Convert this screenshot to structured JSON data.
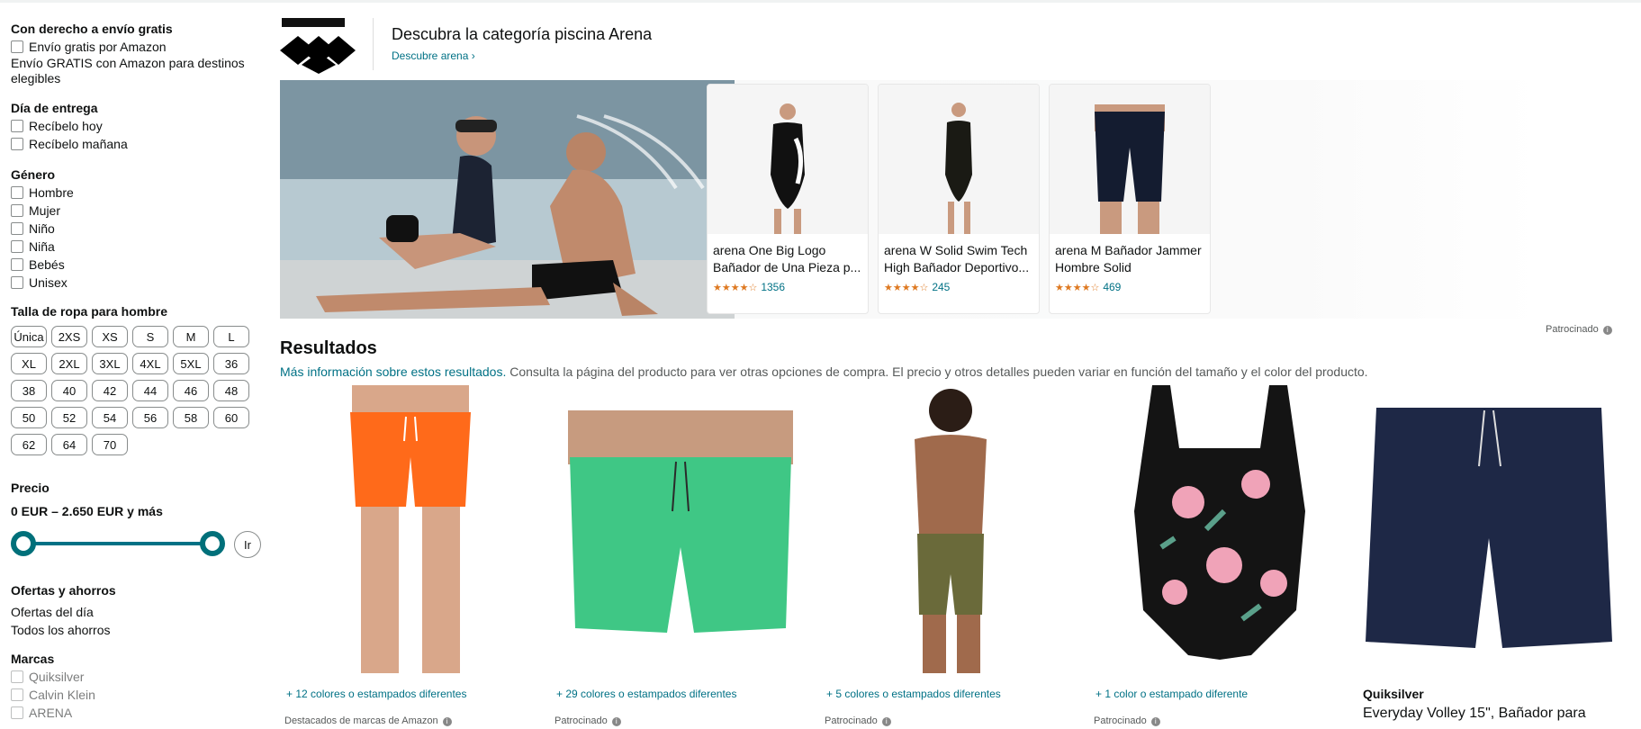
{
  "sidebar": {
    "free_shipping": {
      "title": "Con derecho a envío gratis",
      "option": "Envío gratis por Amazon",
      "note": "Envío GRATIS con Amazon para destinos elegibles"
    },
    "delivery": {
      "title": "Día de entrega",
      "options": [
        "Recíbelo hoy",
        "Recíbelo mañana"
      ]
    },
    "gender": {
      "title": "Género",
      "options": [
        "Hombre",
        "Mujer",
        "Niño",
        "Niña",
        "Bebés",
        "Unisex"
      ]
    },
    "sizes": {
      "title": "Talla de ropa para hombre",
      "options": [
        "Única",
        "2XS",
        "XS",
        "S",
        "M",
        "L",
        "XL",
        "2XL",
        "3XL",
        "4XL",
        "5XL",
        "36",
        "38",
        "40",
        "42",
        "44",
        "46",
        "48",
        "50",
        "52",
        "54",
        "56",
        "58",
        "60",
        "62",
        "64",
        "70"
      ]
    },
    "price": {
      "title": "Precio",
      "range": "0 EUR – 2.650 EUR y más",
      "go_label": "Ir"
    },
    "deals": {
      "title": "Ofertas y ahorros",
      "links": [
        "Ofertas del día",
        "Todos los ahorros"
      ]
    },
    "brands": {
      "title": "Marcas",
      "options": [
        "Quiksilver",
        "Calvin Klein",
        "ARENA"
      ]
    }
  },
  "brand_header": {
    "title": "Descubra la categoría piscina Arena",
    "link": "Descubre arena ›"
  },
  "banner": {
    "products": [
      {
        "title": "arena One Big Logo Bañador de Una Pieza p...",
        "stars": "★★★★☆",
        "reviews": "1356"
      },
      {
        "title": "arena W Solid Swim Tech High Bañador Deportivo...",
        "stars": "★★★★☆",
        "reviews": "245"
      },
      {
        "title": "arena M Bañador Jammer Hombre Solid",
        "stars": "★★★★☆",
        "reviews": "469"
      }
    ],
    "sponsored_label": "Patrocinado"
  },
  "results": {
    "title": "Resultados",
    "info_link": "Más información sobre estos resultados.",
    "info_text": " Consulta la página del producto para ver otras opciones de compra. El precio y otros detalles pueden variar en función del tamaño y el color del producto.",
    "cards": [
      {
        "colors": "+ 12 colores o estampados diferentes",
        "label": "Destacados de marcas de Amazon"
      },
      {
        "colors": "+ 29 colores o estampados diferentes",
        "label": "Patrocinado"
      },
      {
        "colors": "+ 5 colores o estampados diferentes",
        "label": "Patrocinado"
      },
      {
        "colors": "+ 1 color o estampado diferente",
        "label": "Patrocinado"
      },
      {
        "brand": "Quiksilver",
        "title": "Everyday Volley 15\", Bañador para"
      }
    ]
  },
  "colors": {
    "link": "#007185",
    "slider": "#00707a",
    "star": "#de7921"
  }
}
